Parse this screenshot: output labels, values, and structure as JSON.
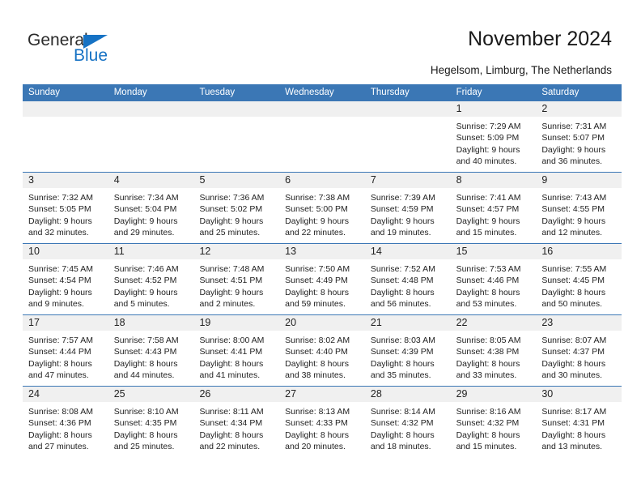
{
  "brand": {
    "word_one": "General",
    "word_two": "Blue",
    "triangle_icon": "triangle-icon",
    "accent_color": "#1672c4"
  },
  "header": {
    "title": "November 2024",
    "subtitle": "Hegelsom, Limburg, The Netherlands"
  },
  "calendar": {
    "header_bg": "#3b77b5",
    "daynum_bg": "#f0f0f0",
    "weekday_headers": [
      "Sunday",
      "Monday",
      "Tuesday",
      "Wednesday",
      "Thursday",
      "Friday",
      "Saturday"
    ],
    "weeks": [
      [
        {
          "day": "",
          "lines": []
        },
        {
          "day": "",
          "lines": []
        },
        {
          "day": "",
          "lines": []
        },
        {
          "day": "",
          "lines": []
        },
        {
          "day": "",
          "lines": []
        },
        {
          "day": "1",
          "lines": [
            "Sunrise: 7:29 AM",
            "Sunset: 5:09 PM",
            "Daylight: 9 hours",
            "and 40 minutes."
          ]
        },
        {
          "day": "2",
          "lines": [
            "Sunrise: 7:31 AM",
            "Sunset: 5:07 PM",
            "Daylight: 9 hours",
            "and 36 minutes."
          ]
        }
      ],
      [
        {
          "day": "3",
          "lines": [
            "Sunrise: 7:32 AM",
            "Sunset: 5:05 PM",
            "Daylight: 9 hours",
            "and 32 minutes."
          ]
        },
        {
          "day": "4",
          "lines": [
            "Sunrise: 7:34 AM",
            "Sunset: 5:04 PM",
            "Daylight: 9 hours",
            "and 29 minutes."
          ]
        },
        {
          "day": "5",
          "lines": [
            "Sunrise: 7:36 AM",
            "Sunset: 5:02 PM",
            "Daylight: 9 hours",
            "and 25 minutes."
          ]
        },
        {
          "day": "6",
          "lines": [
            "Sunrise: 7:38 AM",
            "Sunset: 5:00 PM",
            "Daylight: 9 hours",
            "and 22 minutes."
          ]
        },
        {
          "day": "7",
          "lines": [
            "Sunrise: 7:39 AM",
            "Sunset: 4:59 PM",
            "Daylight: 9 hours",
            "and 19 minutes."
          ]
        },
        {
          "day": "8",
          "lines": [
            "Sunrise: 7:41 AM",
            "Sunset: 4:57 PM",
            "Daylight: 9 hours",
            "and 15 minutes."
          ]
        },
        {
          "day": "9",
          "lines": [
            "Sunrise: 7:43 AM",
            "Sunset: 4:55 PM",
            "Daylight: 9 hours",
            "and 12 minutes."
          ]
        }
      ],
      [
        {
          "day": "10",
          "lines": [
            "Sunrise: 7:45 AM",
            "Sunset: 4:54 PM",
            "Daylight: 9 hours",
            "and 9 minutes."
          ]
        },
        {
          "day": "11",
          "lines": [
            "Sunrise: 7:46 AM",
            "Sunset: 4:52 PM",
            "Daylight: 9 hours",
            "and 5 minutes."
          ]
        },
        {
          "day": "12",
          "lines": [
            "Sunrise: 7:48 AM",
            "Sunset: 4:51 PM",
            "Daylight: 9 hours",
            "and 2 minutes."
          ]
        },
        {
          "day": "13",
          "lines": [
            "Sunrise: 7:50 AM",
            "Sunset: 4:49 PM",
            "Daylight: 8 hours",
            "and 59 minutes."
          ]
        },
        {
          "day": "14",
          "lines": [
            "Sunrise: 7:52 AM",
            "Sunset: 4:48 PM",
            "Daylight: 8 hours",
            "and 56 minutes."
          ]
        },
        {
          "day": "15",
          "lines": [
            "Sunrise: 7:53 AM",
            "Sunset: 4:46 PM",
            "Daylight: 8 hours",
            "and 53 minutes."
          ]
        },
        {
          "day": "16",
          "lines": [
            "Sunrise: 7:55 AM",
            "Sunset: 4:45 PM",
            "Daylight: 8 hours",
            "and 50 minutes."
          ]
        }
      ],
      [
        {
          "day": "17",
          "lines": [
            "Sunrise: 7:57 AM",
            "Sunset: 4:44 PM",
            "Daylight: 8 hours",
            "and 47 minutes."
          ]
        },
        {
          "day": "18",
          "lines": [
            "Sunrise: 7:58 AM",
            "Sunset: 4:43 PM",
            "Daylight: 8 hours",
            "and 44 minutes."
          ]
        },
        {
          "day": "19",
          "lines": [
            "Sunrise: 8:00 AM",
            "Sunset: 4:41 PM",
            "Daylight: 8 hours",
            "and 41 minutes."
          ]
        },
        {
          "day": "20",
          "lines": [
            "Sunrise: 8:02 AM",
            "Sunset: 4:40 PM",
            "Daylight: 8 hours",
            "and 38 minutes."
          ]
        },
        {
          "day": "21",
          "lines": [
            "Sunrise: 8:03 AM",
            "Sunset: 4:39 PM",
            "Daylight: 8 hours",
            "and 35 minutes."
          ]
        },
        {
          "day": "22",
          "lines": [
            "Sunrise: 8:05 AM",
            "Sunset: 4:38 PM",
            "Daylight: 8 hours",
            "and 33 minutes."
          ]
        },
        {
          "day": "23",
          "lines": [
            "Sunrise: 8:07 AM",
            "Sunset: 4:37 PM",
            "Daylight: 8 hours",
            "and 30 minutes."
          ]
        }
      ],
      [
        {
          "day": "24",
          "lines": [
            "Sunrise: 8:08 AM",
            "Sunset: 4:36 PM",
            "Daylight: 8 hours",
            "and 27 minutes."
          ]
        },
        {
          "day": "25",
          "lines": [
            "Sunrise: 8:10 AM",
            "Sunset: 4:35 PM",
            "Daylight: 8 hours",
            "and 25 minutes."
          ]
        },
        {
          "day": "26",
          "lines": [
            "Sunrise: 8:11 AM",
            "Sunset: 4:34 PM",
            "Daylight: 8 hours",
            "and 22 minutes."
          ]
        },
        {
          "day": "27",
          "lines": [
            "Sunrise: 8:13 AM",
            "Sunset: 4:33 PM",
            "Daylight: 8 hours",
            "and 20 minutes."
          ]
        },
        {
          "day": "28",
          "lines": [
            "Sunrise: 8:14 AM",
            "Sunset: 4:32 PM",
            "Daylight: 8 hours",
            "and 18 minutes."
          ]
        },
        {
          "day": "29",
          "lines": [
            "Sunrise: 8:16 AM",
            "Sunset: 4:32 PM",
            "Daylight: 8 hours",
            "and 15 minutes."
          ]
        },
        {
          "day": "30",
          "lines": [
            "Sunrise: 8:17 AM",
            "Sunset: 4:31 PM",
            "Daylight: 8 hours",
            "and 13 minutes."
          ]
        }
      ]
    ]
  }
}
